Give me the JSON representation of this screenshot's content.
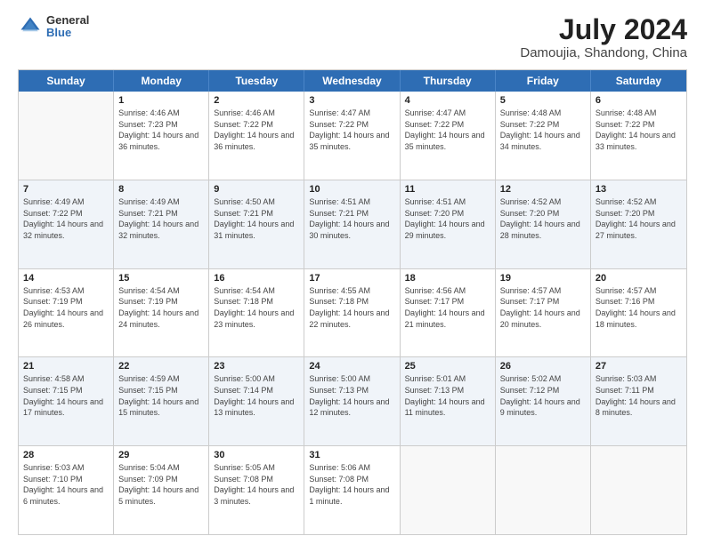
{
  "header": {
    "logo": {
      "general": "General",
      "blue": "Blue"
    },
    "title": "July 2024",
    "location": "Damoujia, Shandong, China"
  },
  "days": [
    "Sunday",
    "Monday",
    "Tuesday",
    "Wednesday",
    "Thursday",
    "Friday",
    "Saturday"
  ],
  "rows": [
    [
      {
        "day": "",
        "empty": true
      },
      {
        "day": "1",
        "sunrise": "Sunrise: 4:46 AM",
        "sunset": "Sunset: 7:23 PM",
        "daylight": "Daylight: 14 hours and 36 minutes."
      },
      {
        "day": "2",
        "sunrise": "Sunrise: 4:46 AM",
        "sunset": "Sunset: 7:22 PM",
        "daylight": "Daylight: 14 hours and 36 minutes."
      },
      {
        "day": "3",
        "sunrise": "Sunrise: 4:47 AM",
        "sunset": "Sunset: 7:22 PM",
        "daylight": "Daylight: 14 hours and 35 minutes."
      },
      {
        "day": "4",
        "sunrise": "Sunrise: 4:47 AM",
        "sunset": "Sunset: 7:22 PM",
        "daylight": "Daylight: 14 hours and 35 minutes."
      },
      {
        "day": "5",
        "sunrise": "Sunrise: 4:48 AM",
        "sunset": "Sunset: 7:22 PM",
        "daylight": "Daylight: 14 hours and 34 minutes."
      },
      {
        "day": "6",
        "sunrise": "Sunrise: 4:48 AM",
        "sunset": "Sunset: 7:22 PM",
        "daylight": "Daylight: 14 hours and 33 minutes."
      }
    ],
    [
      {
        "day": "7",
        "sunrise": "Sunrise: 4:49 AM",
        "sunset": "Sunset: 7:22 PM",
        "daylight": "Daylight: 14 hours and 32 minutes."
      },
      {
        "day": "8",
        "sunrise": "Sunrise: 4:49 AM",
        "sunset": "Sunset: 7:21 PM",
        "daylight": "Daylight: 14 hours and 32 minutes."
      },
      {
        "day": "9",
        "sunrise": "Sunrise: 4:50 AM",
        "sunset": "Sunset: 7:21 PM",
        "daylight": "Daylight: 14 hours and 31 minutes."
      },
      {
        "day": "10",
        "sunrise": "Sunrise: 4:51 AM",
        "sunset": "Sunset: 7:21 PM",
        "daylight": "Daylight: 14 hours and 30 minutes."
      },
      {
        "day": "11",
        "sunrise": "Sunrise: 4:51 AM",
        "sunset": "Sunset: 7:20 PM",
        "daylight": "Daylight: 14 hours and 29 minutes."
      },
      {
        "day": "12",
        "sunrise": "Sunrise: 4:52 AM",
        "sunset": "Sunset: 7:20 PM",
        "daylight": "Daylight: 14 hours and 28 minutes."
      },
      {
        "day": "13",
        "sunrise": "Sunrise: 4:52 AM",
        "sunset": "Sunset: 7:20 PM",
        "daylight": "Daylight: 14 hours and 27 minutes."
      }
    ],
    [
      {
        "day": "14",
        "sunrise": "Sunrise: 4:53 AM",
        "sunset": "Sunset: 7:19 PM",
        "daylight": "Daylight: 14 hours and 26 minutes."
      },
      {
        "day": "15",
        "sunrise": "Sunrise: 4:54 AM",
        "sunset": "Sunset: 7:19 PM",
        "daylight": "Daylight: 14 hours and 24 minutes."
      },
      {
        "day": "16",
        "sunrise": "Sunrise: 4:54 AM",
        "sunset": "Sunset: 7:18 PM",
        "daylight": "Daylight: 14 hours and 23 minutes."
      },
      {
        "day": "17",
        "sunrise": "Sunrise: 4:55 AM",
        "sunset": "Sunset: 7:18 PM",
        "daylight": "Daylight: 14 hours and 22 minutes."
      },
      {
        "day": "18",
        "sunrise": "Sunrise: 4:56 AM",
        "sunset": "Sunset: 7:17 PM",
        "daylight": "Daylight: 14 hours and 21 minutes."
      },
      {
        "day": "19",
        "sunrise": "Sunrise: 4:57 AM",
        "sunset": "Sunset: 7:17 PM",
        "daylight": "Daylight: 14 hours and 20 minutes."
      },
      {
        "day": "20",
        "sunrise": "Sunrise: 4:57 AM",
        "sunset": "Sunset: 7:16 PM",
        "daylight": "Daylight: 14 hours and 18 minutes."
      }
    ],
    [
      {
        "day": "21",
        "sunrise": "Sunrise: 4:58 AM",
        "sunset": "Sunset: 7:15 PM",
        "daylight": "Daylight: 14 hours and 17 minutes."
      },
      {
        "day": "22",
        "sunrise": "Sunrise: 4:59 AM",
        "sunset": "Sunset: 7:15 PM",
        "daylight": "Daylight: 14 hours and 15 minutes."
      },
      {
        "day": "23",
        "sunrise": "Sunrise: 5:00 AM",
        "sunset": "Sunset: 7:14 PM",
        "daylight": "Daylight: 14 hours and 13 minutes."
      },
      {
        "day": "24",
        "sunrise": "Sunrise: 5:00 AM",
        "sunset": "Sunset: 7:13 PM",
        "daylight": "Daylight: 14 hours and 12 minutes."
      },
      {
        "day": "25",
        "sunrise": "Sunrise: 5:01 AM",
        "sunset": "Sunset: 7:13 PM",
        "daylight": "Daylight: 14 hours and 11 minutes."
      },
      {
        "day": "26",
        "sunrise": "Sunrise: 5:02 AM",
        "sunset": "Sunset: 7:12 PM",
        "daylight": "Daylight: 14 hours and 9 minutes."
      },
      {
        "day": "27",
        "sunrise": "Sunrise: 5:03 AM",
        "sunset": "Sunset: 7:11 PM",
        "daylight": "Daylight: 14 hours and 8 minutes."
      }
    ],
    [
      {
        "day": "28",
        "sunrise": "Sunrise: 5:03 AM",
        "sunset": "Sunset: 7:10 PM",
        "daylight": "Daylight: 14 hours and 6 minutes."
      },
      {
        "day": "29",
        "sunrise": "Sunrise: 5:04 AM",
        "sunset": "Sunset: 7:09 PM",
        "daylight": "Daylight: 14 hours and 5 minutes."
      },
      {
        "day": "30",
        "sunrise": "Sunrise: 5:05 AM",
        "sunset": "Sunset: 7:08 PM",
        "daylight": "Daylight: 14 hours and 3 minutes."
      },
      {
        "day": "31",
        "sunrise": "Sunrise: 5:06 AM",
        "sunset": "Sunset: 7:08 PM",
        "daylight": "Daylight: 14 hours and 1 minute."
      },
      {
        "day": "",
        "empty": true
      },
      {
        "day": "",
        "empty": true
      },
      {
        "day": "",
        "empty": true
      }
    ]
  ]
}
